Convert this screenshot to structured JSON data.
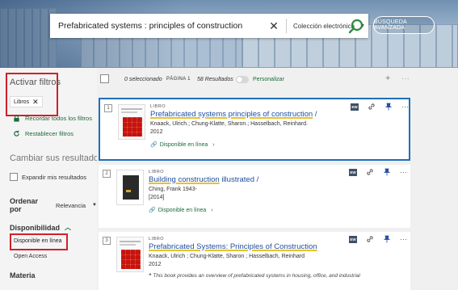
{
  "search": {
    "query": "Prefabricated systems : principles of construction",
    "clear_icon": "close-icon",
    "scope": "Colección electrónica",
    "search_icon": "search-icon",
    "advanced_label": "BÚSQUEDA AVANZADA"
  },
  "sidebar": {
    "activar_filtros": "Activar filtros",
    "chip_label": "Libros",
    "recordar_label": "Recordar todos los filtros",
    "restablecer_label": "Restablecer filtros",
    "cambiar_label": "Cambiar sus resultados",
    "expandir_label": "Expandir mis resultados",
    "ordenar_label": "Ordenar por",
    "ordenar_value": "Relevancia",
    "disponibilidad_label": "Disponibilidad",
    "disponible_label": "Disponible en línea",
    "open_access_label": "Open Access",
    "materia_label": "Materia"
  },
  "toolbar": {
    "selected": "0 seleccionado",
    "page": "PÁGINA 1",
    "count": "58 Resultados",
    "personalizar": "Personalizar"
  },
  "results": [
    {
      "num": "1",
      "type": "LIBRO",
      "title_main": "Prefabricated systems principles of construction",
      "title_tail": " /",
      "author": "Knaack, Ulrich.; Chung-Klatte, Sharon.; Hasselbach, Reinhard.",
      "year": "2012",
      "avail": "Disponible en línea"
    },
    {
      "num": "2",
      "type": "LIBRO",
      "title_a": "Building",
      "title_b": " construction",
      "title_c": " illustrated",
      "title_tail": " /",
      "author": "Ching, Frank 1943-",
      "year": "[2014]",
      "avail": "Disponible en línea"
    },
    {
      "num": "3",
      "type": "LIBRO",
      "title_main": "Prefabricated Systems: Principles of Construction",
      "author": "Knaack, Ulrich ; Chung-Klatte, Sharon ; Hasselbach, Reinhard",
      "year": "2012",
      "desc": "This book provides an overview of prefabricated systems in housing, office, and industrial"
    }
  ],
  "actions": {
    "ew_label": "EW",
    "more_label": "···"
  },
  "colors": {
    "accent_green": "#1a6b3a",
    "link_blue": "#1f4fa0",
    "highlight_red": "#d0202b",
    "selection_blue": "#1f6fb8"
  }
}
